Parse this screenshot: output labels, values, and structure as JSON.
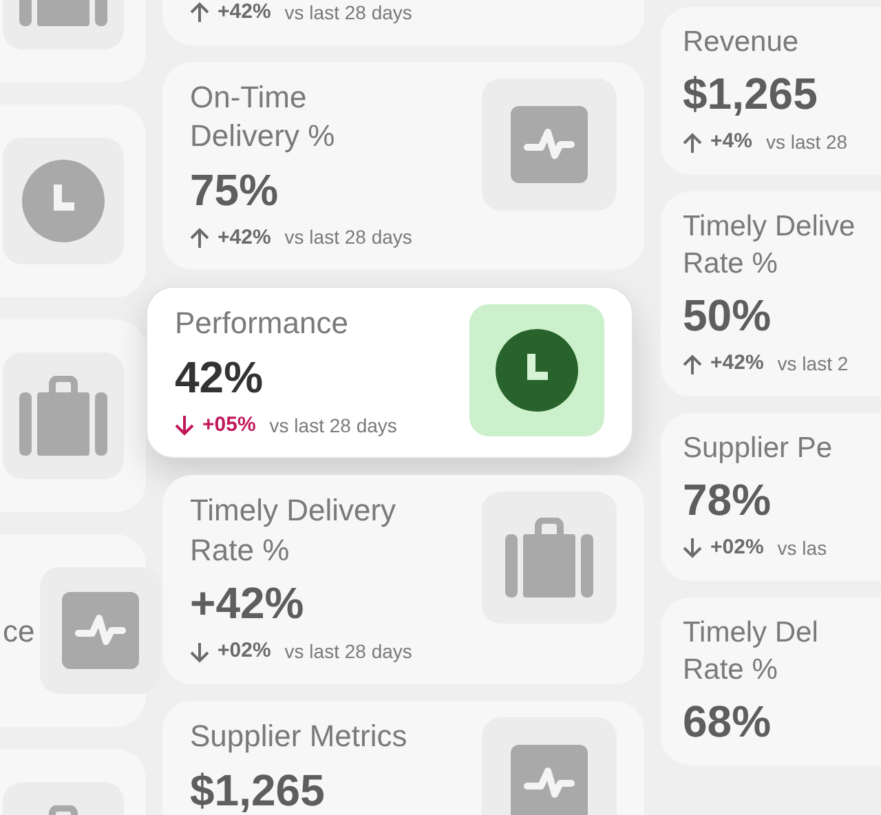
{
  "left_tiles": [
    {
      "icon": {
        "kind": "bag"
      }
    },
    {
      "icon": {
        "kind": "clock"
      }
    },
    {
      "icon": {
        "kind": "bag"
      }
    },
    {
      "icon": {
        "kind": "pulse"
      },
      "text": "ce"
    },
    {
      "icon": {
        "kind": "bag"
      }
    }
  ],
  "center_cards": [
    {
      "trend": {
        "kind": "up",
        "change": "+42%",
        "compare": "vs last 28 days"
      },
      "selected": false
    },
    {
      "title": "On-Time\nDelivery %",
      "value": "75%",
      "trend": {
        "kind": "up",
        "change": "+42%",
        "compare": "vs last 28 days"
      },
      "icon": {
        "kind": "pulse"
      },
      "selected": false
    },
    {
      "title": "Performance",
      "value": "42%",
      "trend": {
        "kind": "down",
        "change": "+05%",
        "compare": "vs last 28 days"
      },
      "icon": {
        "kind": "clock"
      },
      "selected": true
    },
    {
      "title": "Timely Delivery\nRate %",
      "value": "+42%",
      "trend": {
        "kind": "down",
        "change": "+02%",
        "compare": "vs last 28 days"
      },
      "icon": {
        "kind": "bag"
      },
      "selected": false
    },
    {
      "title": "Supplier Metrics",
      "value": "$1,265",
      "icon": {
        "kind": "pulse"
      },
      "selected": false
    }
  ],
  "right_cards": [
    {
      "title": "Revenue",
      "value": "$1,265",
      "trend": {
        "kind": "up",
        "change": "+4%",
        "compare": "vs last 28"
      }
    },
    {
      "title": "Timely Delive\nRate %",
      "value": "50%",
      "trend": {
        "kind": "up",
        "change": "+42%",
        "compare": "vs last 2"
      }
    },
    {
      "title": "Supplier Pe",
      "value": "78%",
      "trend": {
        "kind": "down",
        "change": "+02%",
        "compare": "vs las"
      }
    },
    {
      "title": "Timely Del\nRate %",
      "value": "68%"
    }
  ]
}
